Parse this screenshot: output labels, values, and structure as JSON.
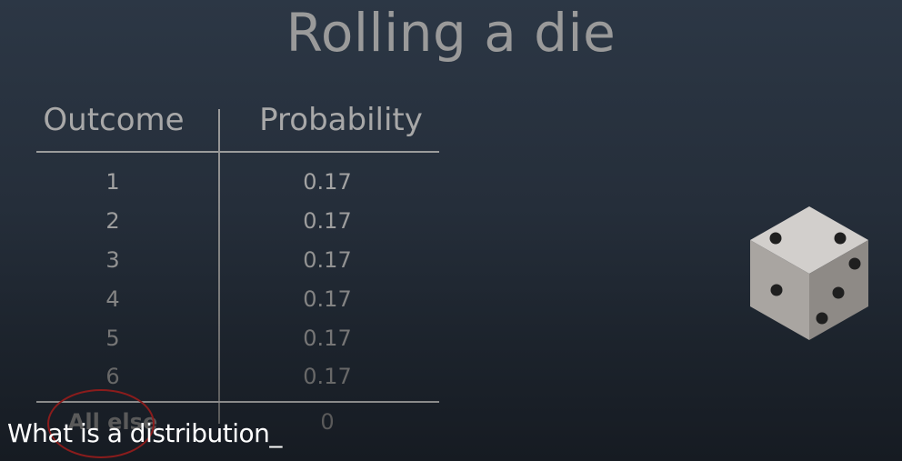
{
  "slide": {
    "title": "Rolling a die"
  },
  "table": {
    "headers": [
      "Outcome",
      "Probability"
    ],
    "rows": [
      {
        "outcome": "1",
        "probability": "0.17"
      },
      {
        "outcome": "2",
        "probability": "0.17"
      },
      {
        "outcome": "3",
        "probability": "0.17"
      },
      {
        "outcome": "4",
        "probability": "0.17"
      },
      {
        "outcome": "5",
        "probability": "0.17"
      },
      {
        "outcome": "6",
        "probability": "0.17"
      }
    ],
    "footer": {
      "outcome": "All else",
      "probability": "0"
    }
  },
  "annotation": {
    "circle_color": "#8a1c1c"
  },
  "die": {
    "icon": "die-icon"
  },
  "caption": {
    "text": "What is a distribution_"
  }
}
